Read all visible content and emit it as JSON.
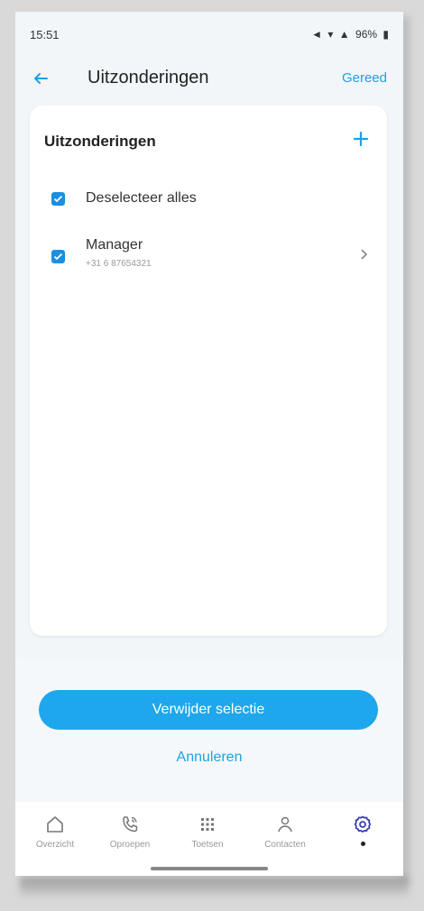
{
  "status": {
    "time": "15:51",
    "battery": "96%"
  },
  "header": {
    "title": "Uitzonderingen",
    "done_label": "Gereed"
  },
  "card": {
    "title": "Uitzonderingen",
    "rows": [
      {
        "label": "Deselecteer alles",
        "checked": true
      },
      {
        "label": "Manager",
        "sub": "+31 6 87654321",
        "checked": true
      }
    ]
  },
  "actions": {
    "primary_label": "Verwijder selectie",
    "cancel_label": "Annuleren"
  },
  "nav": {
    "items": [
      {
        "label": "Overzicht",
        "icon": "home-icon"
      },
      {
        "label": "Oproepen",
        "icon": "phone-icon"
      },
      {
        "label": "Toetsen",
        "icon": "keypad-icon"
      },
      {
        "label": "Contacten",
        "icon": "person-icon"
      },
      {
        "label": "",
        "icon": "gear-icon",
        "active": true
      }
    ]
  },
  "colors": {
    "accent": "#1da1e6",
    "button": "#1ea7ec",
    "active_icon": "#3b3fb0"
  }
}
